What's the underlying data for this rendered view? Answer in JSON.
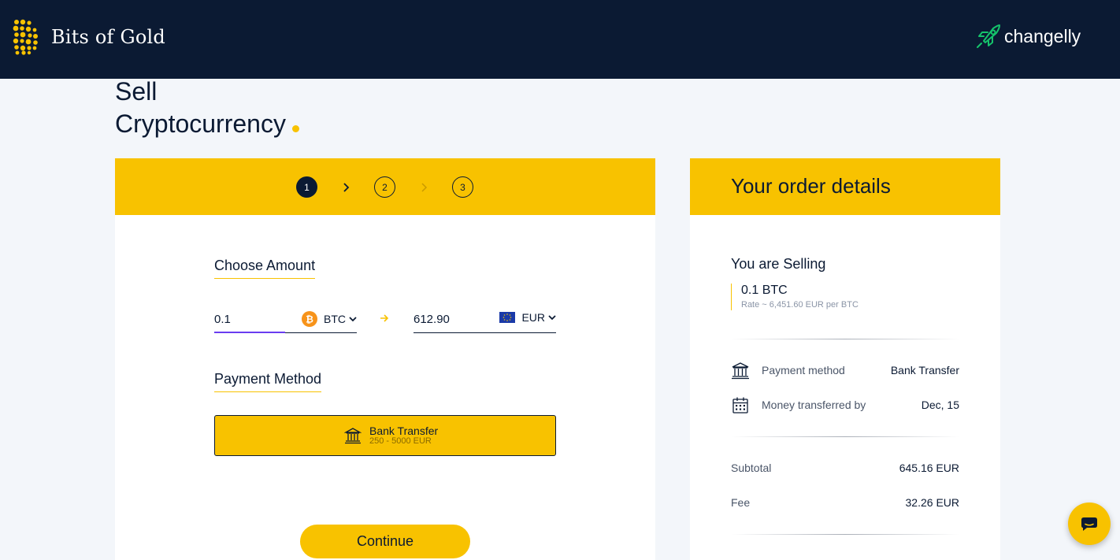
{
  "header": {
    "brand_name": "Bits of Gold",
    "partner_name": "changelly"
  },
  "page": {
    "title_line1": "Sell",
    "title_line2": "Cryptocurrency"
  },
  "stepper": {
    "steps": [
      "1",
      "2",
      "3"
    ],
    "active_step": 1
  },
  "form": {
    "amount_label": "Choose Amount",
    "from_amount": "0.1",
    "from_currency": "BTC",
    "to_amount": "612.90",
    "to_currency": "EUR",
    "payment_label": "Payment Method",
    "payment_option_title": "Bank Transfer",
    "payment_option_range": "250 - 5000 EUR",
    "continue_label": "Continue"
  },
  "order": {
    "title": "Your order details",
    "selling_label": "You are Selling",
    "selling_amount": "0.1 BTC",
    "rate": "Rate ~ 6,451.60 EUR per BTC",
    "payment_method_label": "Payment method",
    "payment_method_value": "Bank Transfer",
    "transfer_by_label": "Money transferred by",
    "transfer_by_value": "Dec, 15",
    "subtotal_label": "Subtotal",
    "subtotal_value": "645.16 EUR",
    "fee_label": "Fee",
    "fee_value": "32.26 EUR"
  },
  "colors": {
    "navy": "#0b1a33",
    "gold": "#f8c200",
    "background": "#f3f6fa",
    "bitcoin": "#f7931a",
    "changelly_green": "#15c36b"
  },
  "icons": {
    "brand": "bits-of-gold-logo",
    "partner": "changelly-rocket-logo",
    "btc": "bitcoin-icon",
    "eur": "eu-flag-icon",
    "bank": "bank-icon",
    "calendar": "calendar-icon",
    "chat": "chat-icon"
  }
}
